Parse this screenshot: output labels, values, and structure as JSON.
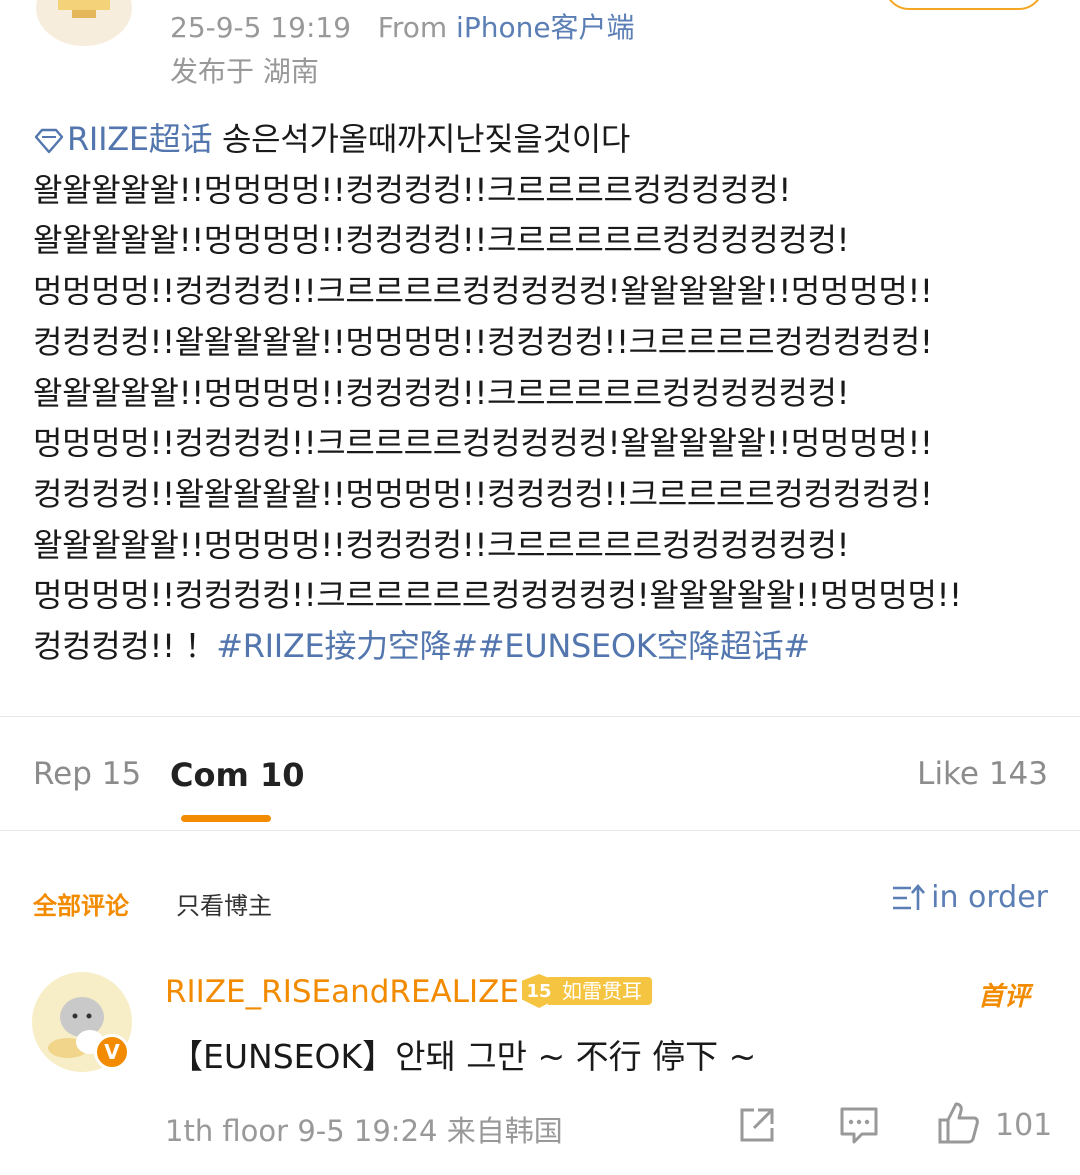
{
  "post": {
    "time": "25-9-5 19:19",
    "from_label": "From",
    "source": "iPhone客户端",
    "location": "发布于 湖南",
    "topic_tag": "RIIZE超话",
    "body_lines": [
      " 송은석가올때까지난짖을것이다",
      "왈왈왈왈왈!!멍멍멍멍!!컹컹컹컹!!크르르르르컹컹컹컹컹!",
      "왈왈왈왈왈!!멍멍멍멍!!컹컹컹컹!!크르르르르르컹컹컹컹컹컹!",
      "멍멍멍멍!!컹컹컹컹!!크르르르르컹컹컹컹컹!왈왈왈왈왈!!멍멍멍멍!!",
      "컹컹컹컹!!왈왈왈왈왈!!멍멍멍멍!!컹컹컹컹!!크르르르르컹컹컹컹컹!",
      "왈왈왈왈왈!!멍멍멍멍!!컹컹컹컹!!크르르르르르컹컹컹컹컹컹!",
      "멍멍멍멍!!컹컹컹컹!!크르르르르컹컹컹컹컹!왈왈왈왈왈!!멍멍멍멍!!",
      "컹컹컹컹!!왈왈왈왈왈!!멍멍멍멍!!컹컹컹컹!!크르르르르컹컹컹컹컹!",
      "왈왈왈왈왈!!멍멍멍멍!!컹컹컹컹!!크르르르르르컹컹컹컹컹컹!",
      "멍멍멍멍!!컹컹컹컹!!크르르르르르컹컹컹컹컹!왈왈왈왈왈!!멍멍멍멍!!"
    ],
    "tail_text": "컹컹컹컹!! ！",
    "hashtags": "#RIIZE接力空降##EUNSEOK空降超话#"
  },
  "tabs": {
    "reposts": "Rep 15",
    "comments": "Com 10",
    "likes": "Like 143"
  },
  "filters": {
    "all": "全部评论",
    "author_only": "只看博主",
    "sort": "in order"
  },
  "comment": {
    "username": "RIIZE_RISEandREALIZE",
    "badge_level": "15",
    "badge_text": "如雷贯耳",
    "first_tag": "首评",
    "text": "【EUNSEOK】안돼 그만 ~ 不行 停下 ~",
    "floor_info": "1th floor  9-5 19:24  来自韩国",
    "like_count": "101"
  },
  "colors": {
    "accent_orange": "#f28b00",
    "link_blue": "#5276ad",
    "muted_gray": "#999999"
  }
}
